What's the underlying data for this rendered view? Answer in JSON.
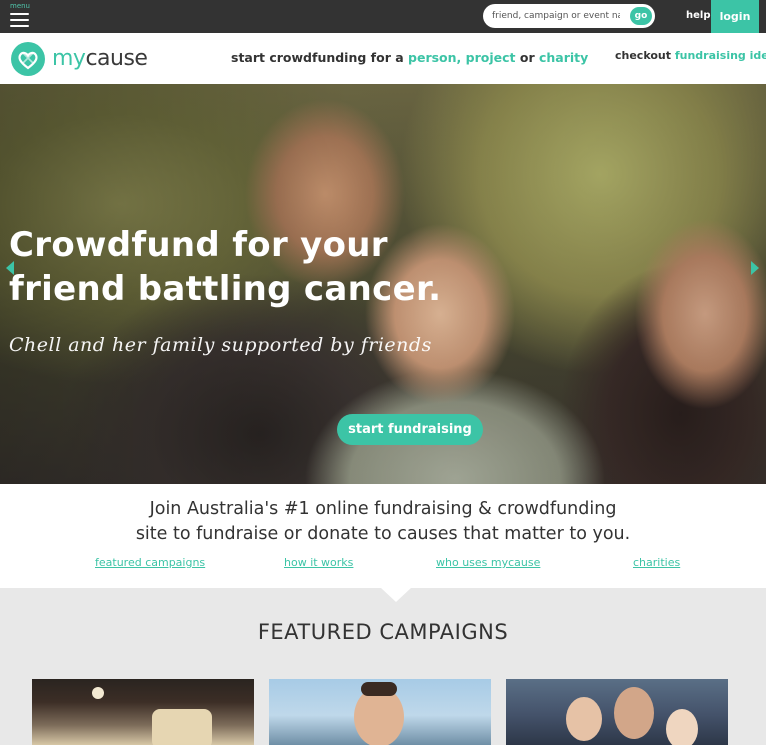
{
  "topbar": {
    "menu_label": "menu",
    "search_placeholder": "friend, campaign or event name",
    "go_label": "go",
    "help_label": "help",
    "login_label": "login"
  },
  "header": {
    "logo_my": "my",
    "logo_cause": "cause",
    "tagline_prefix": "start crowdfunding for a",
    "tagline_person": "person,",
    "tagline_project": "project",
    "tagline_or": "or",
    "tagline_charity": "charity",
    "checkout_prefix": "checkout",
    "checkout_link": "fundraising ideas"
  },
  "hero": {
    "title_line1": "Crowdfund for your",
    "title_line2": "friend battling cancer.",
    "subtitle": "Chell and her family supported by friends",
    "cta_label": "start fundraising"
  },
  "intro": {
    "line1": "Join Australia's #1 online fundraising & crowdfunding",
    "line2": "site to fundraise or donate to causes that matter to you.",
    "links": [
      "featured campaigns",
      "how it works",
      "who uses mycause",
      "charities"
    ]
  },
  "featured": {
    "title": "FEATURED CAMPAIGNS"
  },
  "colors": {
    "accent": "#3cc4a6",
    "topbar": "#333333"
  }
}
